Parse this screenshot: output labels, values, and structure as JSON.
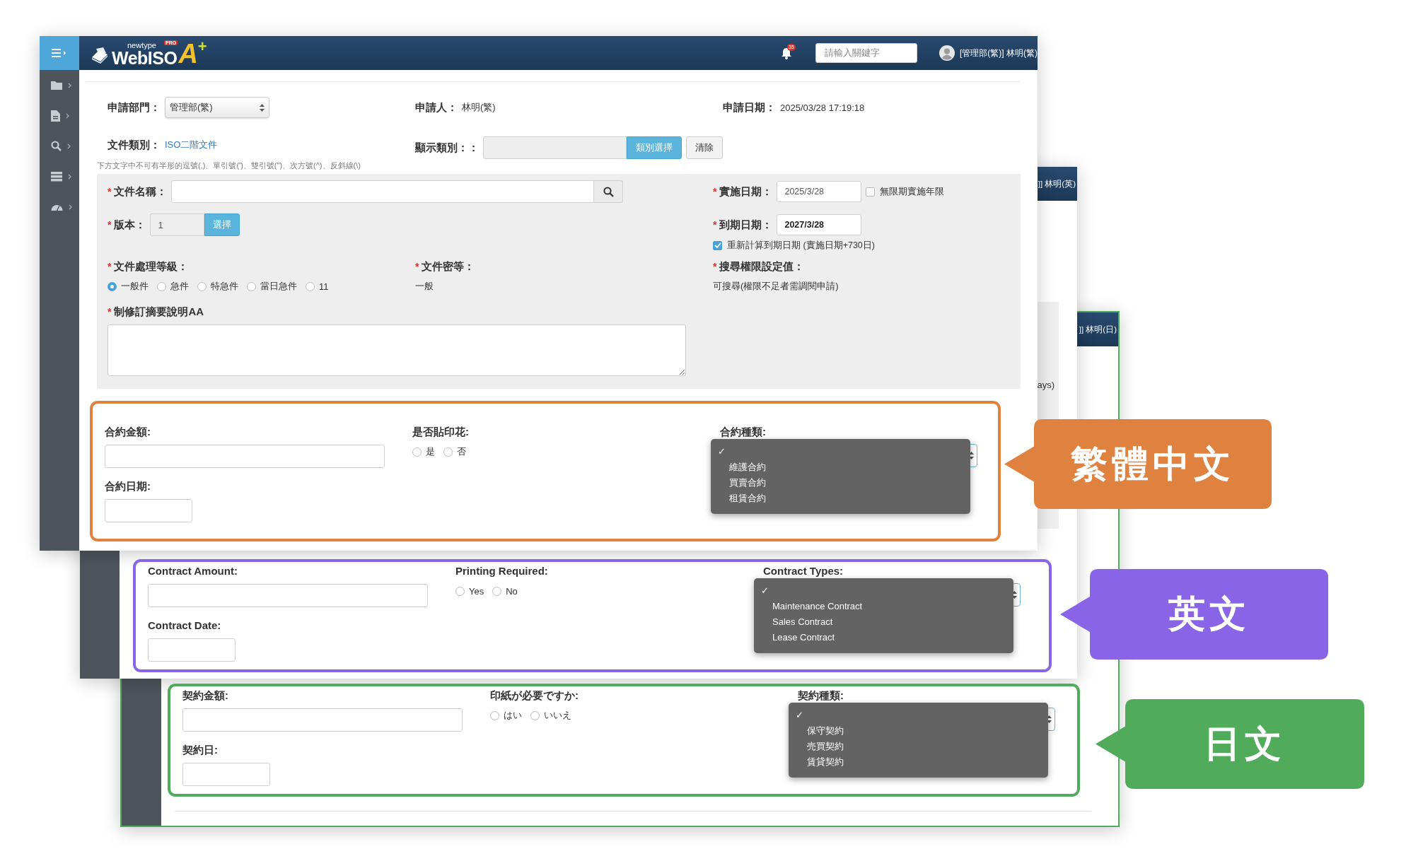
{
  "main_window": {
    "logo": {
      "brand": "newtype",
      "name": "WebISO",
      "mark": "A",
      "plus": "+",
      "badge": "PRO"
    },
    "notification_count": "35",
    "search": {
      "placeholder": "請輸入關鍵字"
    },
    "user": "[管理部(繁)] 林明(繁)",
    "form": {
      "department": {
        "label": "申請部門：",
        "value": "管理部(繁)"
      },
      "applicant": {
        "label": "申請人：",
        "value": "林明(繁)"
      },
      "apply_date": {
        "label": "申請日期：",
        "value": "2025/03/28 17:19:18"
      },
      "doc_category": {
        "label": "文件類別：",
        "value": "ISO二階文件"
      },
      "display_category": {
        "label": "顯示類別：：",
        "select_button": "類別選擇",
        "clear_button": "清除"
      },
      "hint": "下方文字中不可有半形的逗號(,)、單引號(')、雙引號(\")、次方號(^)、反斜線(\\)",
      "doc_name": {
        "req": "*",
        "label": "文件名稱："
      },
      "version": {
        "req": "*",
        "label": "版本：",
        "value": "1",
        "button": "選擇"
      },
      "effective_date": {
        "req": "*",
        "label": "實施日期：",
        "value": "2025/3/28"
      },
      "no_limit": {
        "label": "無限期實施年限",
        "checked": false
      },
      "expiry_date": {
        "req": "*",
        "label": "到期日期：",
        "value": "2027/3/28"
      },
      "recalc": {
        "label": "重新計算到期日期 (實施日期+730日)",
        "checked": true
      },
      "priority": {
        "req": "*",
        "label": "文件處理等級：",
        "options": [
          {
            "label": "一般件",
            "selected": true
          },
          {
            "label": "急件",
            "selected": false
          },
          {
            "label": "特急件",
            "selected": false
          },
          {
            "label": "當日急件",
            "selected": false
          },
          {
            "label": "11",
            "selected": false
          }
        ]
      },
      "secrecy": {
        "req": "*",
        "label": "文件密等：",
        "value": "一般"
      },
      "search_permission": {
        "req": "*",
        "label": "搜尋權限設定值：",
        "value": "可搜尋(權限不足者需調閱申請)"
      },
      "summary": {
        "req": "*",
        "label": "制修訂摘要說明AA"
      }
    }
  },
  "english_window": {
    "user": "]] 林明(英)",
    "cut_text": "ays)"
  },
  "japanese_window": {
    "user": "]] 林明(日)"
  },
  "sections": [
    {
      "color": "#e0823f",
      "amount_label": "合約金額:",
      "date_label": "合約日期:",
      "stamp_label": "是否貼印花:",
      "stamp_options": [
        {
          "label": "是",
          "selected": false
        },
        {
          "label": "否",
          "selected": false
        }
      ],
      "type_label": "合約種類:",
      "checkmark": "✓",
      "type_options": [
        "維護合約",
        "買賣合約",
        "租賃合約"
      ]
    },
    {
      "color": "#8964e6",
      "amount_label": "Contract Amount:",
      "date_label": "Contract Date:",
      "stamp_label": "Printing Required:",
      "stamp_options": [
        {
          "label": "Yes",
          "selected": false
        },
        {
          "label": "No",
          "selected": false
        }
      ],
      "type_label": "Contract Types:",
      "checkmark": "✓",
      "type_options": [
        "Maintenance Contract",
        "Sales Contract",
        "Lease Contract"
      ]
    },
    {
      "color": "#50ab5b",
      "amount_label": "契約金額:",
      "date_label": "契約日:",
      "stamp_label": "印紙が必要ですか:",
      "stamp_options": [
        {
          "label": "はい",
          "selected": false
        },
        {
          "label": "いいえ",
          "selected": false
        }
      ],
      "type_label": "契約種類:",
      "checkmark": "✓",
      "type_options": [
        "保守契約",
        "売買契約",
        "賃貸契約"
      ]
    }
  ],
  "callouts": [
    {
      "text": "繁體中文",
      "color": "#e0823f"
    },
    {
      "text": "英文",
      "color": "#8964e6"
    },
    {
      "text": "日文",
      "color": "#50ab5b"
    }
  ]
}
